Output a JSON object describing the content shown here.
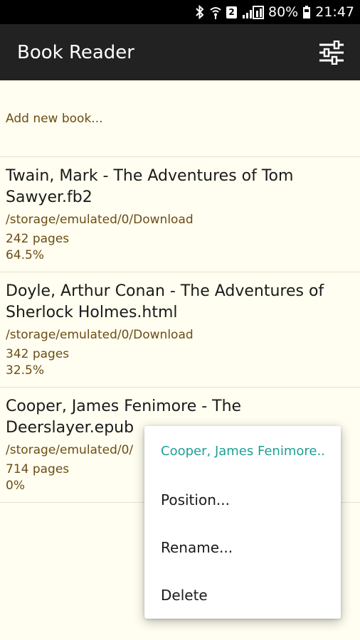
{
  "status_bar": {
    "battery": "80%",
    "time": "21:47",
    "sim_badge": "2",
    "icons": [
      "bluetooth-icon",
      "wifi-icon",
      "sim-icon",
      "signal-icon",
      "battery-icon"
    ]
  },
  "app_bar": {
    "title": "Book Reader",
    "settings_icon": "sliders-icon"
  },
  "list": {
    "add_label": "Add new book...",
    "books": [
      {
        "title": "Twain, Mark - The Adventures of Tom Sawyer.fb2",
        "path": "/storage/emulated/0/Download",
        "pages": "242 pages",
        "progress": "64.5%"
      },
      {
        "title": "Doyle, Arthur Conan - The Adventures of Sherlock Holmes.html",
        "path": "/storage/emulated/0/Download",
        "pages": "342 pages",
        "progress": "32.5%"
      },
      {
        "title": "Cooper, James Fenimore - The Deerslayer.epub",
        "path": "/storage/emulated/0/",
        "pages": "714 pages",
        "progress": "0%"
      }
    ]
  },
  "context_menu": {
    "header": "Cooper, James Fenimore..",
    "items": [
      "Position...",
      "Rename...",
      "Delete"
    ]
  },
  "colors": {
    "background": "#fffef0",
    "app_bar": "#222222",
    "accent": "#1f9e96",
    "secondary_text": "#6b4d16"
  }
}
